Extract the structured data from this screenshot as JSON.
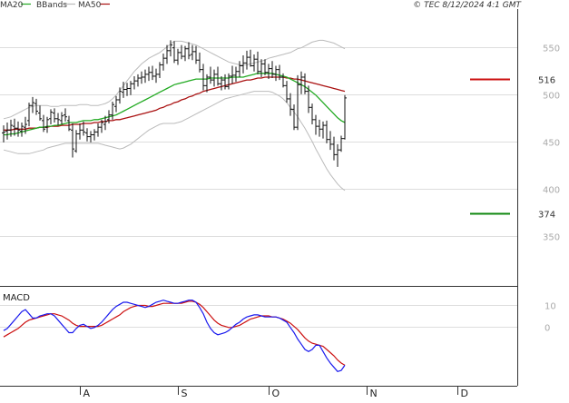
{
  "header": {
    "legend": [
      {
        "label": "MA20",
        "color": "#22aa22"
      },
      {
        "label": "BBands",
        "color": "#bbbbbb"
      },
      {
        "label": "MA50",
        "color": "#aa1111"
      }
    ],
    "copyright": "© TEC 8/12/2024 4:1 GMT"
  },
  "colors": {
    "price": "#111111",
    "ma20": "#22aa22",
    "ma50": "#aa1111",
    "bbands": "#bbbbbb",
    "macd": "#1a1aee",
    "signal": "#cc1111",
    "grid": "#dddddd",
    "support": "#118811",
    "resistance": "#cc1111"
  },
  "chart_data": [
    {
      "type": "line",
      "title": "",
      "ylim": [
        300,
        590
      ],
      "y_ticks": [
        "550",
        "500",
        "450",
        "400",
        "350"
      ],
      "y_tick_values": [
        550,
        500,
        450,
        400,
        350
      ],
      "x_ticks": [
        "A",
        "S",
        "O",
        "N",
        "D"
      ],
      "x_tick_index": [
        21,
        48,
        73,
        100,
        125
      ],
      "levels": [
        {
          "label": "516",
          "value": 516,
          "color": "#cc1111"
        },
        {
          "label": "374",
          "value": 374,
          "color": "#118811"
        }
      ],
      "ohlc": [
        [
          459,
          467,
          449,
          460
        ],
        [
          461,
          470,
          452,
          462
        ],
        [
          462,
          473,
          455,
          467
        ],
        [
          466,
          474,
          456,
          464
        ],
        [
          464,
          471,
          455,
          462
        ],
        [
          461,
          470,
          455,
          466
        ],
        [
          465,
          476,
          458,
          468
        ],
        [
          472,
          491,
          466,
          488
        ],
        [
          488,
          497,
          480,
          491
        ],
        [
          490,
          495,
          478,
          482
        ],
        [
          480,
          488,
          472,
          474
        ],
        [
          472,
          478,
          460,
          463
        ],
        [
          465,
          476,
          459,
          473
        ],
        [
          474,
          484,
          468,
          481
        ],
        [
          480,
          485,
          470,
          474
        ],
        [
          474,
          480,
          467,
          473
        ],
        [
          472,
          481,
          468,
          477
        ],
        [
          478,
          485,
          471,
          476
        ],
        [
          472,
          477,
          461,
          463
        ],
        [
          462,
          469,
          433,
          442
        ],
        [
          440,
          462,
          438,
          458
        ],
        [
          458,
          469,
          452,
          462
        ],
        [
          462,
          471,
          456,
          460
        ],
        [
          459,
          464,
          450,
          455
        ],
        [
          455,
          461,
          449,
          457
        ],
        [
          457,
          463,
          451,
          460
        ],
        [
          460,
          469,
          455,
          465
        ],
        [
          465,
          473,
          459,
          470
        ],
        [
          468,
          477,
          462,
          471
        ],
        [
          473,
          483,
          469,
          478
        ],
        [
          478,
          492,
          473,
          489
        ],
        [
          487,
          498,
          481,
          494
        ],
        [
          494,
          507,
          490,
          503
        ],
        [
          502,
          513,
          496,
          505
        ],
        [
          505,
          512,
          498,
          506
        ],
        [
          506,
          514,
          499,
          511
        ],
        [
          511,
          519,
          505,
          514
        ],
        [
          514,
          521,
          508,
          517
        ],
        [
          517,
          524,
          511,
          518
        ],
        [
          518,
          526,
          512,
          521
        ],
        [
          521,
          529,
          514,
          523
        ],
        [
          523,
          530,
          515,
          519
        ],
        [
          519,
          527,
          512,
          521
        ],
        [
          521,
          534,
          517,
          531
        ],
        [
          531,
          543,
          525,
          538
        ],
        [
          538,
          552,
          532,
          546
        ],
        [
          546,
          557,
          540,
          552
        ],
        [
          549,
          556,
          533,
          536
        ],
        [
          536,
          548,
          531,
          544
        ],
        [
          544,
          552,
          537,
          540
        ],
        [
          540,
          551,
          535,
          548
        ],
        [
          548,
          555,
          537,
          541
        ],
        [
          542,
          552,
          536,
          545
        ],
        [
          545,
          551,
          532,
          536
        ],
        [
          536,
          544,
          523,
          526
        ],
        [
          526,
          532,
          504,
          509
        ],
        [
          509,
          521,
          502,
          518
        ],
        [
          518,
          529,
          511,
          515
        ],
        [
          515,
          526,
          508,
          521
        ],
        [
          521,
          529,
          509,
          511
        ],
        [
          511,
          519,
          504,
          515
        ],
        [
          515,
          521,
          505,
          508
        ],
        [
          508,
          522,
          505,
          519
        ],
        [
          519,
          530,
          511,
          520
        ],
        [
          520,
          529,
          513,
          524
        ],
        [
          524,
          535,
          518,
          530
        ],
        [
          530,
          541,
          522,
          533
        ],
        [
          533,
          546,
          526,
          539
        ],
        [
          539,
          547,
          529,
          530
        ],
        [
          530,
          542,
          524,
          537
        ],
        [
          537,
          545,
          521,
          524
        ],
        [
          524,
          537,
          518,
          532
        ],
        [
          532,
          537,
          520,
          523
        ],
        [
          523,
          532,
          516,
          527
        ],
        [
          527,
          535,
          517,
          521
        ],
        [
          521,
          530,
          514,
          526
        ],
        [
          526,
          531,
          515,
          518
        ],
        [
          518,
          522,
          507,
          509
        ],
        [
          509,
          514,
          491,
          495
        ],
        [
          495,
          501,
          477,
          484
        ],
        [
          484,
          489,
          462,
          465
        ],
        [
          465,
          520,
          462,
          510
        ],
        [
          510,
          524,
          500,
          518
        ],
        [
          518,
          522,
          500,
          503
        ],
        [
          503,
          509,
          480,
          486
        ],
        [
          486,
          490,
          468,
          473
        ],
        [
          473,
          478,
          457,
          466
        ],
        [
          466,
          473,
          455,
          463
        ],
        [
          463,
          471,
          453,
          467
        ],
        [
          467,
          472,
          448,
          452
        ],
        [
          452,
          461,
          441,
          447
        ],
        [
          447,
          455,
          430,
          436
        ],
        [
          436,
          447,
          423,
          441
        ],
        [
          441,
          456,
          439,
          453
        ],
        [
          453,
          499,
          452,
          496
        ]
      ],
      "series": [
        {
          "name": "MA20",
          "values": [
            457,
            457,
            458,
            458,
            459,
            460,
            461,
            462,
            463,
            464,
            465,
            465,
            466,
            466,
            467,
            467,
            468,
            469,
            470,
            470,
            470,
            471,
            472,
            472,
            472,
            473,
            473,
            474,
            475,
            476,
            477,
            478,
            480,
            482,
            484,
            486,
            488,
            490,
            492,
            494,
            496,
            498,
            500,
            502,
            504,
            506,
            508,
            510,
            511,
            512,
            513,
            514,
            515,
            516,
            516,
            516,
            516,
            517,
            517,
            517,
            517,
            517,
            517,
            518,
            518,
            518,
            518,
            519,
            520,
            521,
            522,
            522,
            522,
            522,
            522,
            521,
            520,
            519,
            518,
            516,
            514,
            512,
            510,
            508,
            505,
            502,
            499,
            495,
            491,
            487,
            483,
            479,
            475,
            472,
            470
          ]
        },
        {
          "name": "MA50",
          "values": [
            462,
            462,
            462,
            463,
            463,
            463,
            463,
            464,
            464,
            464,
            465,
            465,
            465,
            466,
            466,
            466,
            467,
            467,
            467,
            468,
            468,
            468,
            469,
            469,
            469,
            470,
            470,
            471,
            471,
            472,
            472,
            473,
            473,
            474,
            475,
            476,
            477,
            478,
            479,
            480,
            481,
            482,
            483,
            485,
            486,
            488,
            489,
            491,
            492,
            494,
            495,
            497,
            498,
            500,
            501,
            503,
            504,
            505,
            506,
            507,
            508,
            509,
            510,
            511,
            512,
            513,
            514,
            515,
            515,
            516,
            517,
            517,
            518,
            518,
            518,
            518,
            518,
            518,
            517,
            517,
            516,
            516,
            515,
            514,
            513,
            512,
            511,
            510,
            509,
            508,
            507,
            506,
            505,
            504,
            503
          ]
        }
      ],
      "bbands_upper": [
        474,
        475,
        476,
        478,
        480,
        482,
        484,
        486,
        487,
        488,
        488,
        488,
        488,
        487,
        487,
        487,
        488,
        488,
        488,
        488,
        488,
        489,
        489,
        489,
        488,
        488,
        488,
        489,
        490,
        492,
        495,
        499,
        504,
        509,
        514,
        519,
        524,
        528,
        532,
        535,
        538,
        540,
        542,
        544,
        547,
        550,
        553,
        556,
        556,
        556,
        555,
        554,
        553,
        552,
        550,
        548,
        546,
        544,
        542,
        540,
        538,
        536,
        534,
        533,
        532,
        531,
        531,
        531,
        532,
        533,
        534,
        535,
        536,
        538,
        539,
        540,
        541,
        542,
        543,
        544,
        546,
        548,
        549,
        551,
        553,
        555,
        556,
        557,
        557,
        556,
        555,
        554,
        552,
        550,
        548
      ],
      "bbands_lower": [
        441,
        440,
        439,
        438,
        437,
        437,
        437,
        437,
        438,
        439,
        440,
        441,
        443,
        444,
        445,
        446,
        447,
        448,
        448,
        448,
        448,
        448,
        448,
        448,
        448,
        448,
        448,
        447,
        446,
        445,
        444,
        443,
        442,
        443,
        445,
        447,
        450,
        453,
        456,
        459,
        462,
        464,
        466,
        468,
        469,
        469,
        469,
        469,
        470,
        471,
        473,
        475,
        477,
        479,
        481,
        483,
        485,
        487,
        489,
        491,
        493,
        495,
        496,
        497,
        498,
        499,
        500,
        501,
        502,
        503,
        503,
        503,
        503,
        503,
        502,
        500,
        498,
        495,
        491,
        486,
        481,
        476,
        470,
        464,
        457,
        450,
        442,
        435,
        428,
        421,
        415,
        410,
        405,
        401,
        398
      ]
    },
    {
      "type": "line",
      "title": "MACD",
      "ylim": [
        -27,
        18
      ],
      "y_ticks": [
        "10",
        "0"
      ],
      "y_tick_values": [
        10,
        0
      ],
      "series": [
        {
          "name": "MACD",
          "values": [
            -2.0,
            -1.0,
            1.0,
            3.0,
            5.0,
            7.0,
            8.0,
            6.0,
            4.0,
            4.0,
            5.0,
            5.5,
            6.0,
            6.0,
            5.0,
            3.0,
            1.0,
            -1.0,
            -3.0,
            -3.0,
            -1.0,
            0.5,
            1.0,
            0.0,
            -1.0,
            -0.5,
            0.5,
            2.0,
            4.0,
            6.0,
            8.0,
            9.5,
            10.5,
            11.5,
            11.5,
            11.0,
            10.5,
            10.0,
            9.5,
            9.0,
            9.5,
            10.5,
            11.5,
            12.0,
            12.5,
            12.0,
            11.5,
            11.0,
            11.0,
            11.5,
            12.0,
            12.5,
            12.5,
            11.5,
            9.0,
            6.0,
            2.0,
            -1.0,
            -3.0,
            -4.0,
            -3.5,
            -3.0,
            -2.0,
            -0.5,
            1.0,
            2.0,
            3.5,
            4.5,
            5.0,
            5.5,
            5.5,
            5.0,
            4.5,
            4.5,
            4.5,
            4.5,
            4.0,
            3.0,
            2.0,
            -0.5,
            -3.0,
            -6.0,
            -8.5,
            -11.0,
            -12.0,
            -11.0,
            -9.0,
            -9.0,
            -12.0,
            -15.0,
            -17.5,
            -19.5,
            -21.5,
            -21.0,
            -18.5
          ]
        },
        {
          "name": "Signal",
          "values": [
            -5.0,
            -4.0,
            -3.0,
            -2.0,
            -1.0,
            0.5,
            2.0,
            3.0,
            3.5,
            4.0,
            4.5,
            5.0,
            5.5,
            6.0,
            6.0,
            5.5,
            5.0,
            4.0,
            3.0,
            1.5,
            0.5,
            0.0,
            0.0,
            0.0,
            0.0,
            0.0,
            0.0,
            0.5,
            1.5,
            2.5,
            3.5,
            4.5,
            5.5,
            7.0,
            8.0,
            9.0,
            9.5,
            10.0,
            10.0,
            10.0,
            9.5,
            9.5,
            10.0,
            10.5,
            11.0,
            11.0,
            11.0,
            11.0,
            11.0,
            11.0,
            11.5,
            12.0,
            12.0,
            11.5,
            10.5,
            9.0,
            7.0,
            5.0,
            3.0,
            1.5,
            0.5,
            0.0,
            -0.5,
            -0.5,
            0.0,
            0.5,
            1.5,
            2.5,
            3.5,
            4.0,
            4.5,
            5.0,
            5.0,
            5.0,
            4.5,
            4.5,
            4.0,
            3.5,
            2.5,
            1.5,
            0.0,
            -1.5,
            -3.5,
            -5.5,
            -7.0,
            -8.0,
            -8.5,
            -9.0,
            -9.5,
            -11.0,
            -12.5,
            -14.0,
            -16.0,
            -17.5,
            -18.5
          ]
        }
      ]
    }
  ]
}
